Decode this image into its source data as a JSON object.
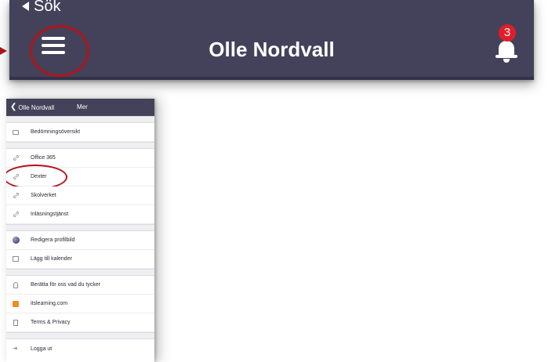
{
  "header": {
    "back_label": "Sök",
    "title": "Olle Nordvall",
    "notification_count": "3"
  },
  "panel": {
    "back_label": "Olle Nordvall",
    "title": "Mer",
    "items": [
      {
        "label": "Bedömningsöversikt",
        "icon": "folder-icon"
      },
      {
        "label": "Office 365",
        "icon": "link-icon"
      },
      {
        "label": "Dexter",
        "icon": "link-icon"
      },
      {
        "label": "Skolverket",
        "icon": "link-icon"
      },
      {
        "label": "Inläsningstjänst",
        "icon": "link-icon"
      },
      {
        "label": "Redigera profilbild",
        "icon": "profile-picture-icon"
      },
      {
        "label": "Lägg till kalender",
        "icon": "calendar-icon"
      },
      {
        "label": "Berätta för oss vad du tycker",
        "icon": "lightbulb-icon"
      },
      {
        "label": "itslearning.com",
        "icon": "itslearning-icon"
      },
      {
        "label": "Terms & Privacy",
        "icon": "document-icon"
      },
      {
        "label": "Logga ut",
        "icon": "logout-icon"
      }
    ]
  },
  "colors": {
    "header_bg": "#43425a",
    "annotation_red": "#b0141c",
    "badge_red": "#e01e2a"
  }
}
